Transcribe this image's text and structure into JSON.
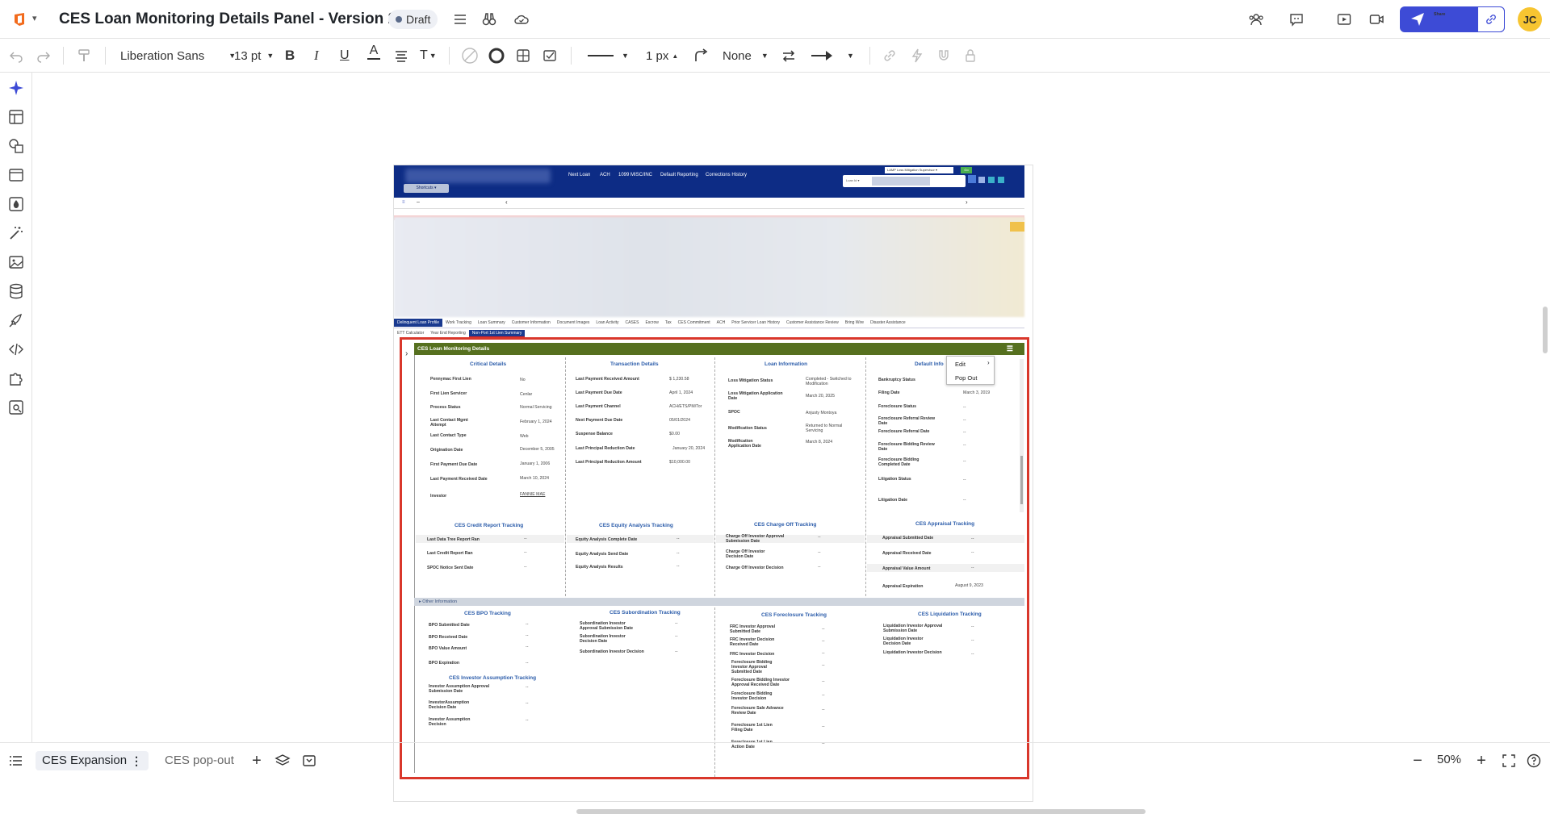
{
  "app": {
    "title": "CES Loan Monitoring Details Panel - Version 2",
    "status": "Draft",
    "share_label": "Share",
    "avatar_initials": "JC",
    "accent_color": "#3d4bd6",
    "avatar_color": "#f7c531"
  },
  "toolbar": {
    "font_family": "Liberation Sans",
    "font_size": "13 pt",
    "line_width": "1 px",
    "arrow_start": "None"
  },
  "pages": {
    "active": "CES Expansion",
    "inactive": "CES pop-out"
  },
  "zoom": "50%",
  "mock": {
    "nav": [
      "Next Loan",
      "ACH",
      "1099 MISC/INC",
      "Default Reporting",
      "Corrections History"
    ],
    "shortcuts": "Shortcuts ▾",
    "select_label": "LAMP Loss Mitigation Supervisor ▾",
    "go": "Go",
    "loan_id_placeholder": "Loan Id ▾",
    "tabs": [
      "Delinquent Loan Profile",
      "Work Tracking",
      "Loan Summary",
      "Customer Information",
      "Document Images",
      "Loan Activity",
      "CASES",
      "Escrow",
      "Tax",
      "CES Commitment",
      "ACH",
      "Prior Servicer Loan History",
      "Customer Assistance Review",
      "Bring Wire",
      "Disaster Assistance"
    ],
    "subtabs": [
      "ETT Calculator",
      "Year End Reporting",
      "Non-Port 1st Lien Summary"
    ],
    "panel_title": "CES Loan Monitoring Details",
    "menu_items": [
      "Edit",
      "Pop Out"
    ],
    "other_info": "▸ Other Information",
    "sections": {
      "critical": {
        "title": "Critical Details",
        "rows": [
          [
            "Pennymac First Lien",
            "No"
          ],
          [
            "First Lien Servicer",
            "Cenlar"
          ],
          [
            "Process Status",
            "Normal Servicing"
          ],
          [
            "Last Contact Mgmt Attempt",
            "February 1, 2024"
          ],
          [
            "Last Contact Type",
            "Web"
          ],
          [
            "Origination Date",
            "December 5, 2005"
          ],
          [
            "First Payment Due Date",
            "January 1, 2006"
          ],
          [
            "Last Payment Received Date",
            "March 10, 2024"
          ],
          [
            "Investor",
            "FANNIE MAE"
          ]
        ]
      },
      "transaction": {
        "title": "Transaction Details",
        "rows": [
          [
            "Last Payment Received Amount",
            "$ 1,230.58"
          ],
          [
            "Last Payment Due Date",
            "April 1, 2024"
          ],
          [
            "Last Payment Channel",
            "ACH/ETS/PM/Tor"
          ],
          [
            "Next Payment Due Date",
            "05/01/2024"
          ],
          [
            "Suspense Balance",
            "$0.00"
          ],
          [
            "Last Principal Reduction Date",
            "January 20, 2024"
          ],
          [
            "Last Principal Reduction Amount",
            "$10,000.00"
          ]
        ]
      },
      "loan": {
        "title": "Loan Information",
        "rows": [
          [
            "Loss Mitigation Status",
            "Completed - Switched to Modification"
          ],
          [
            "Loss Mitigation Application Date",
            "March 20, 2025"
          ],
          [
            "SPOC",
            "Anjusty Montoya"
          ],
          [
            "Modification Status",
            "Returned to Normal Servicing"
          ],
          [
            "Modification Application Date",
            "March 8, 2024"
          ]
        ]
      },
      "default": {
        "title": "Default Info",
        "rows": [
          [
            "Bankruptcy Status",
            "--"
          ],
          [
            "Filing Date",
            "March 3, 2019"
          ],
          [
            "Foreclosure Status",
            "--"
          ],
          [
            "Foreclosure Referral Review Date",
            "--"
          ],
          [
            "Foreclosure Referral Date",
            "--"
          ],
          [
            "Foreclosure Bidding Review Date",
            "--"
          ],
          [
            "Foreclosure Bidding Completed Date",
            "--"
          ],
          [
            "Litigation Status",
            "--"
          ],
          [
            "Litigation Date",
            "--"
          ]
        ]
      },
      "credit": {
        "title": "CES Credit Report Tracking",
        "rows": [
          [
            "Last Data Tree Report Ran",
            "--"
          ],
          [
            "Last Credit Report Ran",
            "--"
          ],
          [
            "SPOC Notice Sent Date",
            "--"
          ]
        ]
      },
      "equity": {
        "title": "CES Equity Analysis Tracking",
        "rows": [
          [
            "Equity Analysis Complete Date",
            "--"
          ],
          [
            "Equity Analysis Send Date",
            "--"
          ],
          [
            "Equity Analysis Results",
            "--"
          ]
        ]
      },
      "chargeoff": {
        "title": "CES Charge Off Tracking",
        "rows": [
          [
            "Charge Off Investor Approval Submission Date",
            "--"
          ],
          [
            "Charge Off Investor Decision Date",
            "--"
          ],
          [
            "Charge Off Investor Decision",
            "--"
          ]
        ]
      },
      "appraisal": {
        "title": "CES Appraisal Tracking",
        "rows": [
          [
            "Appraisal Submitted Date",
            "--"
          ],
          [
            "Appraisal Received Date",
            "--"
          ],
          [
            "Appraisal Value Amount",
            "--"
          ],
          [
            "Appraisal Expiration",
            "August 9, 2023"
          ]
        ]
      },
      "bpo": {
        "title": "CES BPO Tracking",
        "rows": [
          [
            "BPO Submitted Date",
            "--"
          ],
          [
            "BPO Received Date",
            "--"
          ],
          [
            "BPO Value Amount",
            "--"
          ],
          [
            "BPO Expiration",
            "--"
          ]
        ]
      },
      "subordination": {
        "title": "CES Subordination Tracking",
        "rows": [
          [
            "Subordination Investor Approval Submission Date",
            "--"
          ],
          [
            "Subordination Investor Decision Date",
            "--"
          ],
          [
            "Subordination Investor Decision",
            "--"
          ]
        ]
      },
      "foreclosure": {
        "title": "CES Foreclosure Tracking",
        "rows": [
          [
            "FRC Investor Approval Submitted Date",
            "--"
          ],
          [
            "FRC Investor Decision Received Date",
            "--"
          ],
          [
            "FRC Investor Decision",
            "--"
          ],
          [
            "Foreclosure Bidding Investor Approval Submitted Date",
            "--"
          ],
          [
            "Foreclosure Bidding Investor Approval Received Date",
            "--"
          ],
          [
            "Foreclosure Bidding Investor Decision",
            "--"
          ],
          [
            "Foreclosure Sale Advance Review Date",
            "--"
          ],
          [
            "Foreclosure 1st Lien Filing Date",
            "--"
          ],
          [
            "Foreclosure 1st Lien Action Date",
            "--"
          ]
        ]
      },
      "liquidation": {
        "title": "CES Liquidation Tracking",
        "rows": [
          [
            "Liquidation Investor Approval Submission Date",
            "--"
          ],
          [
            "Liquidation Investor Decision Date",
            "--"
          ],
          [
            "Liquidation Investor Decision",
            "--"
          ]
        ]
      },
      "assumption": {
        "title": "CES Investor Assumption Tracking",
        "rows": [
          [
            "Investor Assumption Approval Submission Date",
            "--"
          ],
          [
            "InvestorAssumption Decision Date",
            "--"
          ],
          [
            "Investor Assumption Decision",
            "--"
          ]
        ]
      }
    }
  }
}
